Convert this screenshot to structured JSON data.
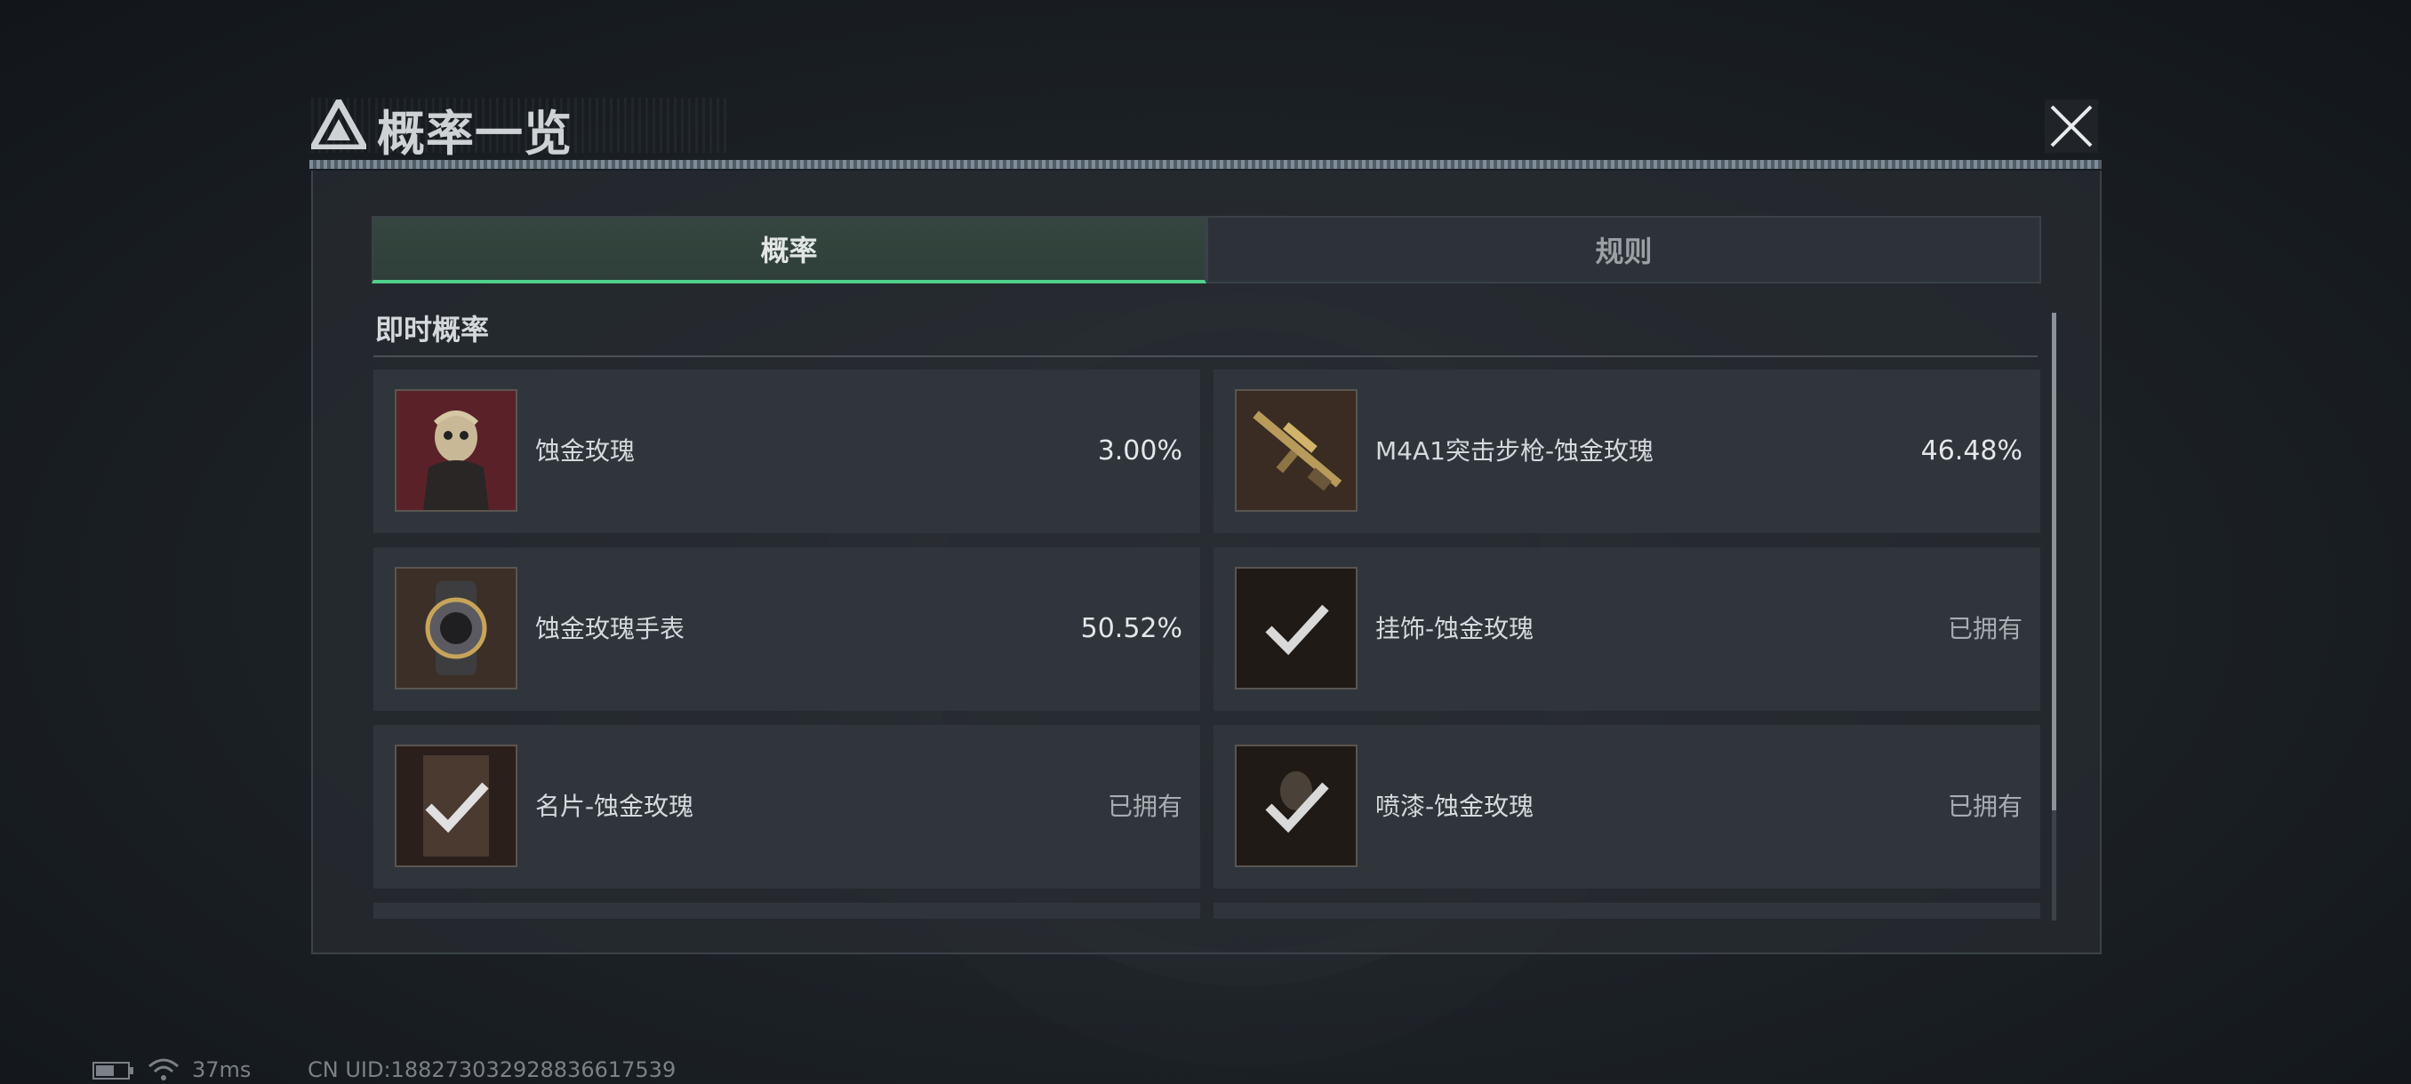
{
  "window": {
    "title": "概率一览"
  },
  "tabs": [
    {
      "label": "概率",
      "active": true
    },
    {
      "label": "规则",
      "active": false
    }
  ],
  "section": {
    "title": "即时概率"
  },
  "items": [
    {
      "name": "蚀金玫瑰",
      "value": "3.00%",
      "icon": "character-skin-icon"
    },
    {
      "name": "M4A1突击步枪-蚀金玫瑰",
      "value": "46.48%",
      "icon": "rifle-icon"
    },
    {
      "name": "蚀金玫瑰手表",
      "value": "50.52%",
      "icon": "watch-icon"
    },
    {
      "name": "挂饰-蚀金玫瑰",
      "value": "已拥有",
      "icon": "charm-owned-icon"
    },
    {
      "name": "名片-蚀金玫瑰",
      "value": "已拥有",
      "icon": "card-owned-icon"
    },
    {
      "name": "喷漆-蚀金玫瑰",
      "value": "已拥有",
      "icon": "spray-owned-icon"
    }
  ],
  "status": {
    "ping": "37ms",
    "uid": "CN UID:18827303292883661753​9"
  },
  "colors": {
    "accent": "#4fd08b",
    "panel": "#2f353b"
  }
}
